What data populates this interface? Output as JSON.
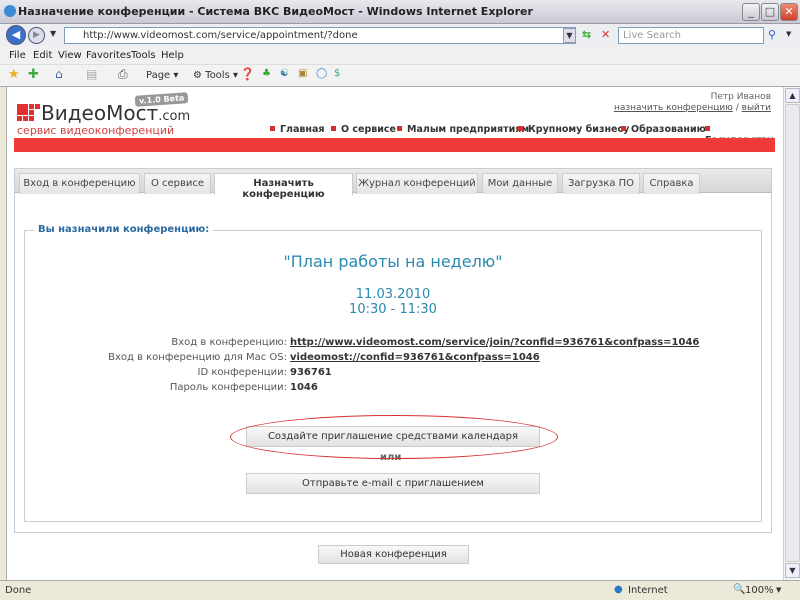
{
  "window": {
    "title": "Назначение конференции - Система ВКС ВидеоМост - Windows Internet Explorer"
  },
  "browser": {
    "url": "http://www.videomost.com/service/appointment/?done",
    "search_placeholder": "Live Search",
    "menu": [
      "File",
      "Edit",
      "View",
      "Favorites",
      "Tools",
      "Help"
    ],
    "toolbar": {
      "page": "Page",
      "tools": "Tools"
    },
    "status": {
      "text": "Done",
      "zone": "Internet",
      "zoom": "100%"
    }
  },
  "site": {
    "logo": "ВидеоМост",
    "logo_suffix": ".com",
    "version": "v.1.0 Beta",
    "tagline": "сервис видеоконференций",
    "user": "Петр Иванов",
    "user_link": "назначить конференцию",
    "sep": "/",
    "logout": "выйти",
    "nav": [
      "Главная",
      "О сервисе",
      "Малым предприятиям",
      "Крупному бизнесу",
      "Образованию",
      "Государству"
    ],
    "colors": {
      "brand": "#f03a3a",
      "accent": "#2a8ab0"
    }
  },
  "tabs": [
    {
      "label": "Вход в конференцию"
    },
    {
      "label": "О сервисе"
    },
    {
      "label": "Назначить конференцию",
      "active": true
    },
    {
      "label": "Журнал конференций"
    },
    {
      "label": "Мои данные"
    },
    {
      "label": "Загрузка ПО"
    },
    {
      "label": "Справка"
    }
  ],
  "conference": {
    "legend": "Вы назначили конференцию:",
    "title": "\"План работы на неделю\"",
    "date": "11.03.2010",
    "time": "10:30 - 11:30",
    "rows": [
      {
        "label": "Вход в конференцию:",
        "value": "http://www.videomost.com/service/join/?confid=936761&confpass=1046"
      },
      {
        "label": "Вход в конференцию для Mac OS:",
        "value": "videomost://confid=936761&confpass=1046"
      },
      {
        "label": "ID конференции:",
        "value": "936761"
      },
      {
        "label": "Пароль конференции:",
        "value": "1046"
      }
    ],
    "calendar_button": "Создайте приглашение средствами календаря",
    "or": "или",
    "email_button": "Отправьте e-mail с приглашением",
    "new_button": "Новая конференция"
  }
}
